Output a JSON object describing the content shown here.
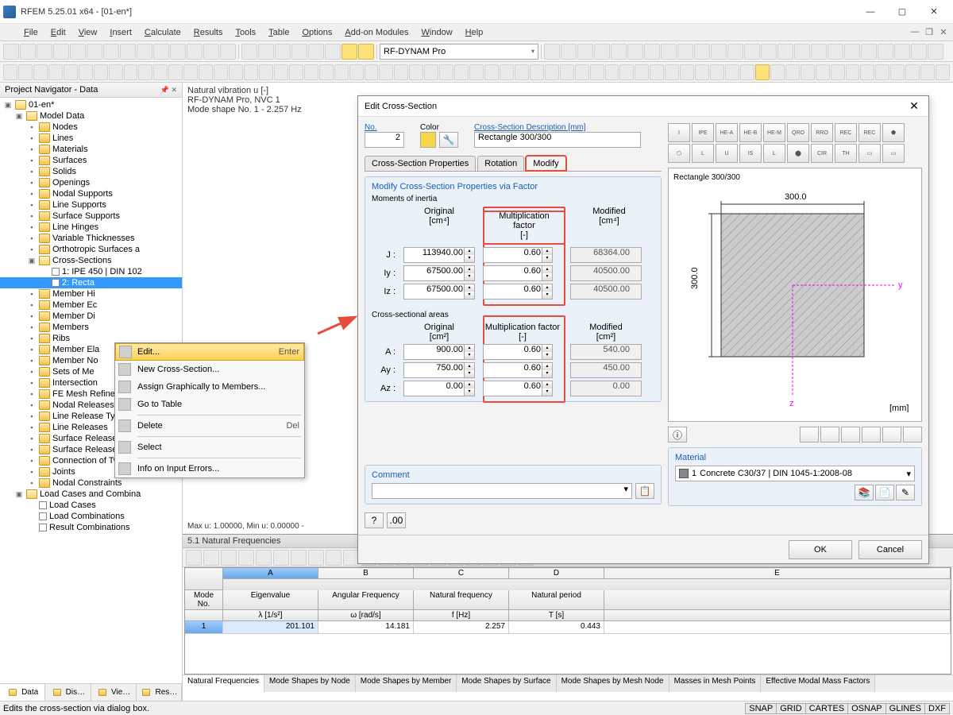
{
  "app": {
    "title": "RFEM 5.25.01 x64 - [01-en*]"
  },
  "menus": [
    "File",
    "Edit",
    "View",
    "Insert",
    "Calculate",
    "Results",
    "Tools",
    "Table",
    "Options",
    "Add-on Modules",
    "Window",
    "Help"
  ],
  "toolbar_combo": "RF-DYNAM Pro",
  "navigator": {
    "title": "Project Navigator - Data",
    "root": "01-en*",
    "model_data": "Model Data",
    "items": [
      "Nodes",
      "Lines",
      "Materials",
      "Surfaces",
      "Solids",
      "Openings",
      "Nodal Supports",
      "Line Supports",
      "Surface Supports",
      "Line Hinges",
      "Variable Thicknesses",
      "Orthotropic Surfaces a"
    ],
    "cross_sections": "Cross-Sections",
    "cs_children": [
      "1: IPE 450 | DIN 102",
      "2: Recta"
    ],
    "items2": [
      "Member Hi",
      "Member Ec",
      "Member Di",
      "Members",
      "Ribs",
      "Member Ela",
      "Member No",
      "Sets of Me",
      "Intersection",
      "FE Mesh Refinements",
      "Nodal Releases",
      "Line Release Types",
      "Line Releases",
      "Surface Release Types",
      "Surface Releases",
      "Connection of Two M",
      "Joints",
      "Nodal Constraints"
    ],
    "load": "Load Cases and Combina",
    "load_children": [
      "Load Cases",
      "Load Combinations",
      "Result Combinations"
    ],
    "tabs": [
      "Data",
      "Dis…",
      "Vie…",
      "Res…"
    ]
  },
  "context_menu": {
    "items": [
      {
        "label": "Edit...",
        "shortcut": "Enter",
        "hover": true
      },
      {
        "label": "New Cross-Section..."
      },
      {
        "label": "Assign Graphically to Members..."
      },
      {
        "label": "Go to Table"
      },
      {
        "sep": true
      },
      {
        "label": "Delete",
        "shortcut": "Del"
      },
      {
        "sep": true
      },
      {
        "label": "Select"
      },
      {
        "sep": true
      },
      {
        "label": "Info on Input Errors..."
      }
    ]
  },
  "viewport": {
    "line1": "Natural vibration u [-]",
    "line2": "RF-DYNAM Pro, NVC 1",
    "line3": "Mode shape No. 1 - 2.257 Hz",
    "status": "Max u: 1.00000, Min u: 0.00000 -"
  },
  "dialog": {
    "title": "Edit Cross-Section",
    "no_label": "No.",
    "no_value": "2",
    "color_label": "Color",
    "desc_label": "Cross-Section Description [mm]",
    "desc_value": "Rectangle 300/300",
    "tabs": [
      "Cross-Section Properties",
      "Rotation",
      "Modify"
    ],
    "group_title": "Modify Cross-Section Properties via Factor",
    "inertia_label": "Moments of inertia",
    "col_original": "Original",
    "col_factor": "Multiplication factor",
    "col_modified": "Modified",
    "unit_cm4": "[cm⁴]",
    "unit_none": "[-]",
    "unit_cm2": "[cm²]",
    "rows_inertia": [
      {
        "label": "J :",
        "orig": "113940.00",
        "factor": "0.60",
        "mod": "68364.00"
      },
      {
        "label": "Iy :",
        "orig": "67500.00",
        "factor": "0.60",
        "mod": "40500.00"
      },
      {
        "label": "Iz :",
        "orig": "67500.00",
        "factor": "0.60",
        "mod": "40500.00"
      }
    ],
    "areas_label": "Cross-sectional areas",
    "rows_area": [
      {
        "label": "A :",
        "orig": "900.00",
        "factor": "0.60",
        "mod": "540.00"
      },
      {
        "label": "Ay :",
        "orig": "750.00",
        "factor": "0.60",
        "mod": "450.00"
      },
      {
        "label": "Az :",
        "orig": "0.00",
        "factor": "0.60",
        "mod": "0.00"
      }
    ],
    "comment_label": "Comment",
    "section_types": [
      "I",
      "IPE",
      "HE-A",
      "HE-B",
      "HE-M",
      "QRO",
      "RRO",
      "REC",
      "REC",
      "⬟",
      "⬡",
      "L",
      "U",
      "IS",
      "L",
      "⬤",
      "CIR",
      "TH",
      "▭",
      "▭"
    ],
    "preview_title": "Rectangle 300/300",
    "preview_dim1": "300.0",
    "preview_dim2": "300.0",
    "preview_unit": "[mm]",
    "material_label": "Material",
    "material_num": "1",
    "material_value": "Concrete C30/37 | DIN 1045-1:2008-08",
    "ok": "OK",
    "cancel": "Cancel"
  },
  "tables": {
    "title": "5.1 Natural Frequencies",
    "col_letters": [
      "A",
      "B",
      "C",
      "D",
      "E"
    ],
    "headers_top": [
      "Mode No.",
      "Eigenvalue",
      "Angular Frequency",
      "Natural frequency",
      "Natural period"
    ],
    "headers_sub": [
      "",
      "λ [1/s²]",
      "ω [rad/s]",
      "f [Hz]",
      "T [s]"
    ],
    "row": {
      "no": "1",
      "eigen": "201.101",
      "ang": "14.181",
      "freq": "2.257",
      "period": "0.443"
    },
    "tabs": [
      "Natural Frequencies",
      "Mode Shapes by Node",
      "Mode Shapes by Member",
      "Mode Shapes by Surface",
      "Mode Shapes by Mesh Node",
      "Masses in Mesh Points",
      "Effective Modal Mass Factors"
    ]
  },
  "statusbar": {
    "hint": "Edits the cross-section via dialog box.",
    "cells": [
      "SNAP",
      "GRID",
      "CARTES",
      "OSNAP",
      "GLINES",
      "DXF"
    ]
  }
}
